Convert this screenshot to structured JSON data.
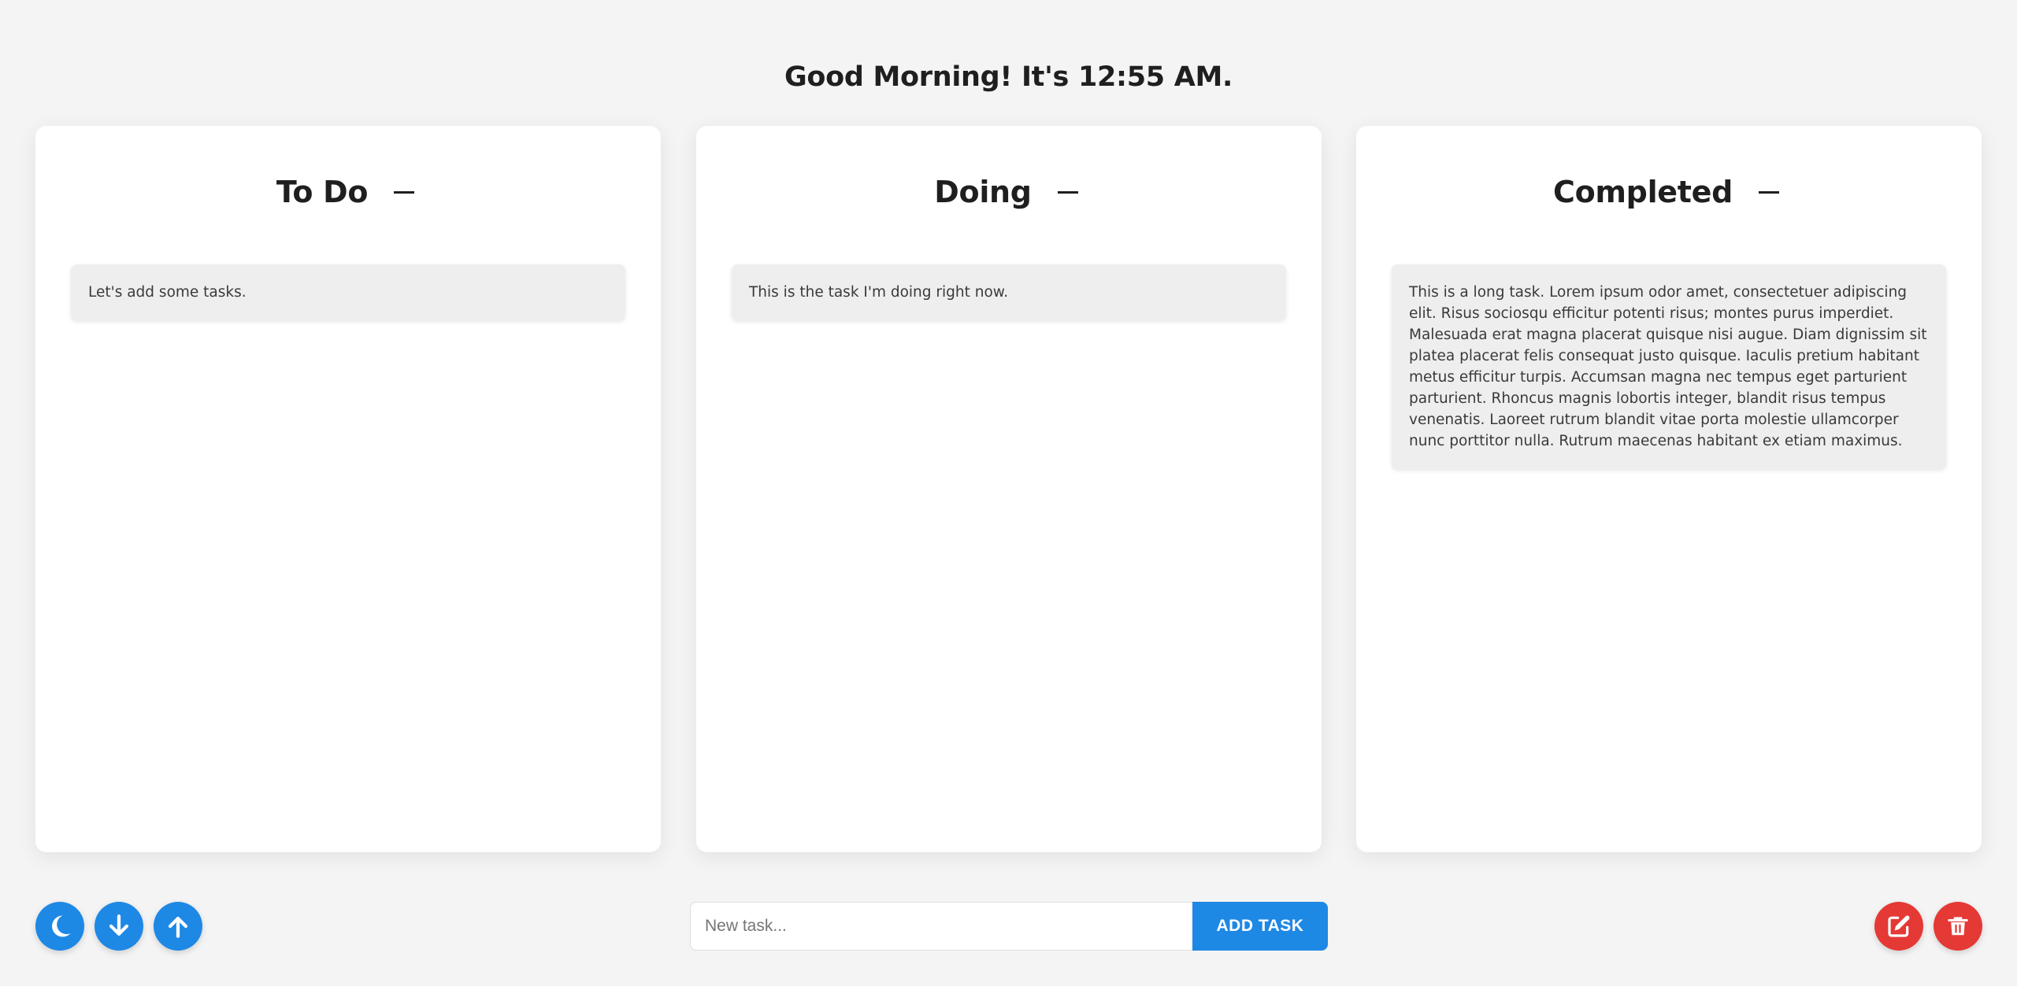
{
  "greeting": "Good Morning! It's 12:55 AM.",
  "columns": [
    {
      "title": "To Do",
      "tasks": [
        "Let's add some tasks."
      ]
    },
    {
      "title": "Doing",
      "tasks": [
        "This is the task I'm doing right now."
      ]
    },
    {
      "title": "Completed",
      "tasks": [
        "This is a long task. Lorem ipsum odor amet, consectetuer adipiscing elit. Risus sociosqu efficitur potenti risus; montes purus imperdiet. Malesuada erat magna placerat quisque nisi augue. Diam dignissim sit platea placerat felis consequat justo quisque. Iaculis pretium habitant metus efficitur turpis. Accumsan magna nec tempus eget parturient parturient. Rhoncus magnis lobortis integer, blandit risus tempus venenatis. Laoreet rutrum blandit vitae porta molestie ullamcorper nunc porttitor nulla. Rutrum maecenas habitant ex etiam maximus."
      ]
    }
  ],
  "input": {
    "value": "",
    "placeholder": "New task..."
  },
  "add_button": "ADD TASK",
  "left_buttons": [
    "moon-icon",
    "arrow-down-icon",
    "arrow-up-icon"
  ],
  "right_buttons": [
    "edit-icon",
    "trash-icon"
  ],
  "colors": {
    "accent": "#1e88e5",
    "danger": "#e53935",
    "background": "#f4f4f4",
    "task": "#eeeeee"
  }
}
